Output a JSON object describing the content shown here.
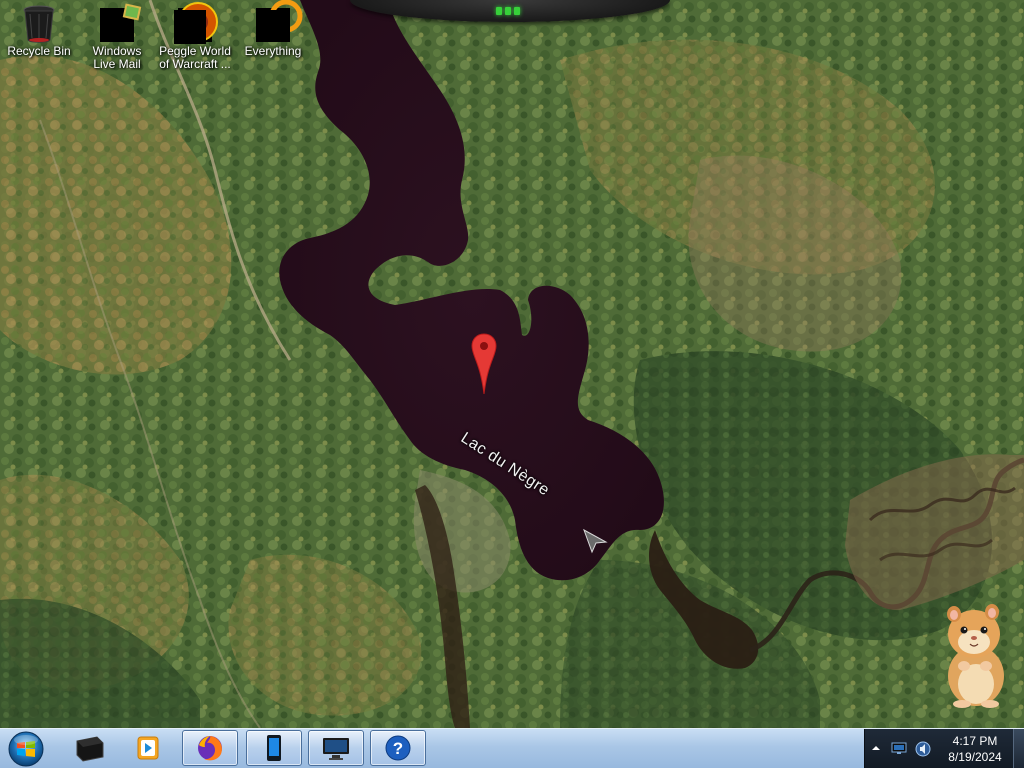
{
  "desktop": {
    "icons": [
      {
        "label": "Recycle Bin",
        "icon": "recycle-bin-icon"
      },
      {
        "label": "Windows Live Mail",
        "icon": "windows-live-mail-icon"
      },
      {
        "label": "Peggle World of Warcraft ...",
        "icon": "peggle-icon"
      },
      {
        "label": "Everything",
        "icon": "everything-search-icon"
      }
    ]
  },
  "map": {
    "place_label": "Lac du Nègre",
    "colors": {
      "water": "#2a0f1c",
      "forest_dark": "#3d5a2c",
      "forest_light": "#7f8a45",
      "autumn": "#9a7a3e",
      "pin": "#e53935"
    }
  },
  "taskbar": {
    "pinned": [
      {
        "name": "desktop-app",
        "icon": "black-box-icon"
      },
      {
        "name": "media-player",
        "icon": "media-player-icon"
      },
      {
        "name": "firefox",
        "icon": "firefox-icon"
      }
    ],
    "running": [
      {
        "name": "phone-app",
        "icon": "phone-icon"
      },
      {
        "name": "remote-desktop",
        "icon": "monitor-icon"
      },
      {
        "name": "help",
        "icon": "help-icon"
      }
    ],
    "clock": {
      "time": "4:17 PM",
      "date": "8/19/2024"
    }
  }
}
